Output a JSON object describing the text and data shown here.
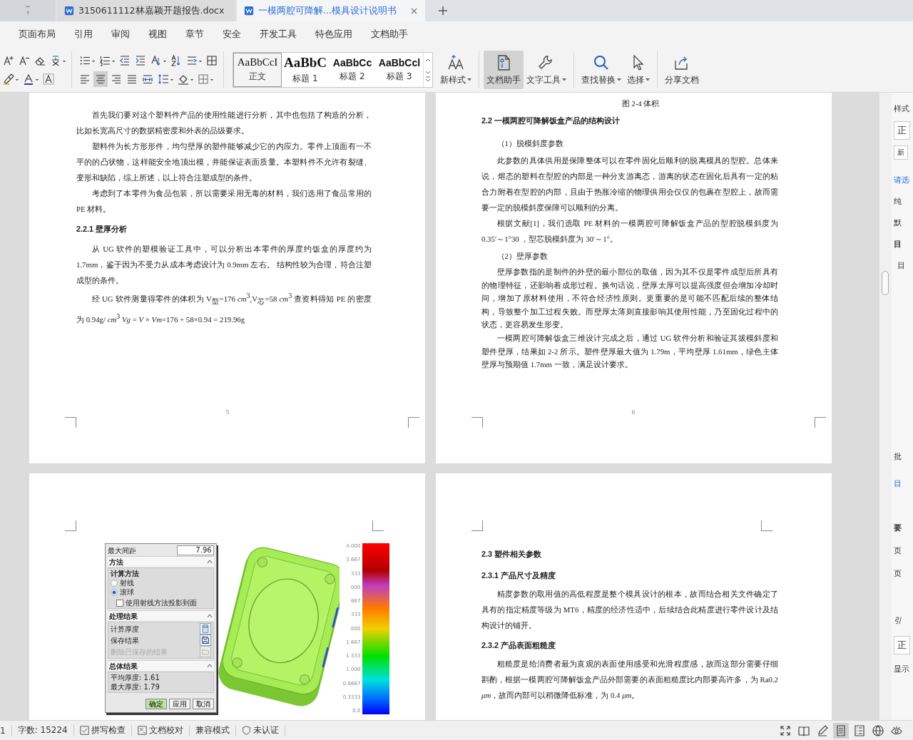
{
  "tabs": [
    {
      "kind": "home",
      "selected": false
    },
    {
      "kind": "doc",
      "title": "3150611112林嘉颖开题报告.docx",
      "selected": false
    },
    {
      "kind": "doc",
      "title": "一模两腔可降解...模具设计说明书",
      "selected": true
    }
  ],
  "menu": [
    "页面布局",
    "引用",
    "审阅",
    "视图",
    "章节",
    "安全",
    "开发工具",
    "特色应用",
    "文档助手"
  ],
  "format_groups": [
    {
      "rows": [
        {
          "tools": [
            {
              "kind": "font-grow",
              "dropdown": false,
              "selected": false
            },
            {
              "kind": "font-shrink",
              "dropdown": false,
              "selected": false
            },
            {
              "kind": "clear-format",
              "dropdown": false,
              "selected": false
            },
            {
              "kind": "pinyin",
              "dropdown": true,
              "selected": false
            }
          ]
        },
        {
          "tools": [
            {
              "kind": "highlight",
              "dropdown": true,
              "selected": false
            },
            {
              "kind": "font-color",
              "dropdown": true,
              "selected": false
            },
            {
              "kind": "char-shading",
              "dropdown": false,
              "selected": false
            }
          ]
        }
      ]
    },
    {
      "rows": [
        {
          "tools": [
            {
              "kind": "bullet-list",
              "dropdown": true,
              "selected": false
            },
            {
              "kind": "numbered-list",
              "dropdown": true,
              "selected": false
            },
            {
              "kind": "outdent",
              "dropdown": false,
              "selected": false
            },
            {
              "kind": "indent",
              "dropdown": false,
              "selected": false
            },
            {
              "kind": "text-direction",
              "dropdown": true,
              "selected": false
            },
            {
              "kind": "sort",
              "dropdown": false,
              "selected": false
            },
            {
              "kind": "para-layout",
              "dropdown": true,
              "selected": false
            },
            {
              "kind": "table",
              "dropdown": false,
              "selected": false
            }
          ]
        },
        {
          "tools": [
            {
              "kind": "align-left",
              "dropdown": false,
              "selected": false
            },
            {
              "kind": "align-center",
              "dropdown": false,
              "selected": true
            },
            {
              "kind": "align-right",
              "dropdown": false,
              "selected": false
            },
            {
              "kind": "justify",
              "dropdown": false,
              "selected": false
            },
            {
              "kind": "distribute",
              "dropdown": false,
              "selected": false
            },
            {
              "kind": "line-spacing",
              "dropdown": true,
              "selected": false
            },
            {
              "kind": "shading",
              "dropdown": true,
              "selected": false
            },
            {
              "kind": "borders",
              "dropdown": true,
              "selected": false
            }
          ]
        }
      ]
    }
  ],
  "styles": [
    {
      "sample": "AaBbCcI",
      "label": "正文",
      "selected": true
    },
    {
      "sample": "AaBbC",
      "label": "标题 1",
      "selected": false
    },
    {
      "sample": "AaBbCc",
      "label": "标题 2",
      "selected": false
    },
    {
      "sample": "AaBbCcl",
      "label": "标题 3",
      "selected": false
    }
  ],
  "big_tools": [
    {
      "kind": "new-style",
      "label": "新样式",
      "dropdown": true,
      "selected": false
    },
    {
      "kind": "doc-assistant",
      "label": "文档助手",
      "dropdown": false,
      "selected": true
    },
    {
      "kind": "text-tools",
      "label": "文字工具",
      "dropdown": true,
      "selected": false
    },
    {
      "kind": "find-replace",
      "label": "查找替换",
      "dropdown": true,
      "selected": false
    },
    {
      "kind": "select",
      "label": "选择",
      "dropdown": true,
      "selected": false
    },
    {
      "kind": "share",
      "label": "分享文档",
      "dropdown": false,
      "selected": false
    }
  ],
  "pages": [
    {
      "page_number": "5",
      "blocks": [
        {
          "kind": "para",
          "text": "首先我们要对这个塑料件产品的使用性能进行分析，其中也包括了构造的分析，比如长宽高尺寸的数据精密度和外表的品级要求。"
        },
        {
          "kind": "para",
          "text": "塑料件为长方形形件，均匀壁厚的塑件能够减少它的内应力。零件上顶面有一不平的的凸状物，这样能安全地顶出模，并能保证表面质量。本塑料件不允许有裂缝、变形和缺陷，综上所述，以上符合注塑成型的条件。"
        },
        {
          "kind": "para",
          "text": "考虑到了本零件为食品包装，所以需要采用无毒的材料，我们选用了食品常用的 PE 材料。"
        },
        {
          "kind": "heading",
          "text": "2.2.1 壁厚分析"
        },
        {
          "kind": "para",
          "text": "从 UG 软件的塑模验证工具中，可以分析出本零件的厚度约饭盒的厚度约为 1.7mm，鉴于因为不受力从成本考虑设计为 0.9mm 左右。 结构性较为合理，符合注塑成型的条件。"
        },
        {
          "kind": "para",
          "text": "经 UG 软件测量得零件的体积为 V$_{型}$=176 *cm*$^{3}$,V$_{芯}$=58 *cm*$^{3}$ 查资料得知 PE 的密度为 0.94g/ *cm*$^{3}$   *Vg* = *V* × *Vm*=176 + 58×0.94 = 219.96g"
        }
      ]
    },
    {
      "page_number": "6",
      "blocks": [
        {
          "kind": "caption",
          "text": "图 2-4 体积"
        },
        {
          "kind": "heading",
          "text": "2.2  一模两腔可降解饭盒产品的结构设计"
        },
        {
          "kind": "sub",
          "text": "（1）脱模斜度参数"
        },
        {
          "kind": "para",
          "text": "此参数的具体供用是保障整体可以在零件固化后顺利的脱离模具的型腔。总体来说，熔态的塑料在型腔的内部是一种分支游离态，游离的状态在固化后具有一定的粘合力附着在型腔的内部，且由于热胀冷缩的物理供用会仅仅的包裹在型腔上，故而需要一定的脱模斜度保障可以顺利的分离。"
        },
        {
          "kind": "para",
          "text": "根据文献[1]，我们选取 PE 材料的一模两腔可降解饭盒产品的型腔脱模斜度为 0.35′～1°30 ，型芯脱模斜度为 30′～1°。"
        },
        {
          "kind": "sub",
          "text": "（2）壁厚参数"
        },
        {
          "kind": "para-tight",
          "text": "壁厚参数指的是制件的外壁的最小部位的取值，因为其不仅是零件成型后所具有的物理特征，还影响着成形过程。换句话说，壁厚太厚可以提高强度但会增加冷却时间，增加了原材料使用，不符合经济性原则。更重要的是可能不匹配后续的整体结构，导致整个加工过程失败。而壁厚太薄则直接影响其使用性能，乃至固化过程中的状态，更容易发生形变。"
        },
        {
          "kind": "para-tight",
          "text": "一模两腔可降解饭盒三维设计完成之后，通过 UG 软件分析和验证其拔模斜度和塑件壁厚，结果如 2-2 所示。塑件壁厚最大值为 1.79m，平均壁厚 1.61mm，绿色主体壁厚与预期值 1.7mm 一致，满足设计要求。"
        }
      ]
    },
    {
      "blocks": [
        {
          "kind": "figure",
          "dialog": {
            "field": {
              "label": "最大间距",
              "value": "7.96"
            },
            "sections": [
              {
                "title": "方法",
                "rows": [
                  {
                    "kind": "group-title",
                    "text": "计算方法"
                  },
                  {
                    "kind": "radio",
                    "text": "射线",
                    "selected": false
                  },
                  {
                    "kind": "radio",
                    "text": "滚球",
                    "selected": true
                  },
                  {
                    "kind": "checkbox",
                    "text": "使用射线方法投影到面",
                    "checked": false
                  }
                ]
              },
              {
                "title": "处理结果",
                "rows": [
                  {
                    "kind": "action",
                    "text": "计算厚度",
                    "disabled": false
                  },
                  {
                    "kind": "action",
                    "text": "保存结果",
                    "disabled": false
                  },
                  {
                    "kind": "action",
                    "text": "删除已保存的结果",
                    "disabled": true
                  }
                ]
              },
              {
                "title": "总体结果",
                "rows": [
                  {
                    "kind": "result",
                    "text": "平均厚度: 1.61"
                  },
                  {
                    "kind": "result",
                    "text": "最大厚度: 1.79"
                  }
                ]
              }
            ],
            "buttons": [
              "确定",
              "应用",
              "取消"
            ]
          },
          "legend": [
            "4.000",
            "3.667",
            "333",
            "000",
            "667",
            "333",
            "000",
            "1.667",
            "1.333",
            "1.000",
            "0.6667",
            "0.3333",
            "0.0"
          ]
        }
      ]
    },
    {
      "blocks": [
        {
          "kind": "heading",
          "text": "2.3 塑件相关参数"
        },
        {
          "kind": "heading",
          "text": "2.3.1 产品尺寸及精度"
        },
        {
          "kind": "para",
          "text": "精度参数的取用值的高低程度是整个模具设计的根本，故而结合相关文件确定了具有的指定精度等级为 MT6，精度的经济性适中，后续结合此精度进行零件设计及结构设计的铺开。"
        },
        {
          "kind": "heading",
          "text": "2.3.2 产品表面粗糙度"
        },
        {
          "kind": "para",
          "text": "粗糙度是给消费者最为直观的表面使用感受和光滑程度感，故而这部分需要仔细斟酌，根据一模两腔可降解饭盒产品外部需要的表面粗糙度比内部要高许多，为 Ra0.2 *μm*，故而内部可以稍微降低标准，为 0.4 *μm*。"
        }
      ]
    }
  ],
  "sidebar": {
    "sections": [
      {
        "items": [
          {
            "kind": "label",
            "text": "样式"
          },
          {
            "kind": "box",
            "text": "正"
          },
          {
            "kind": "small-box",
            "text": "新"
          }
        ]
      },
      {
        "items": [
          {
            "kind": "link",
            "text": "请选"
          },
          {
            "kind": "label",
            "text": "纯"
          },
          {
            "kind": "label",
            "text": "默"
          },
          {
            "kind": "bold",
            "text": "目"
          },
          {
            "kind": "indent",
            "text": "目"
          }
        ]
      },
      {
        "items": [
          {
            "kind": "label",
            "text": "批"
          },
          {
            "kind": "link",
            "text": "目"
          }
        ]
      },
      {
        "items": [
          {
            "kind": "bold",
            "text": "要"
          },
          {
            "kind": "label",
            "text": "页"
          },
          {
            "kind": "label",
            "text": "页"
          }
        ]
      },
      {
        "items": [
          {
            "kind": "italic",
            "text": "引"
          },
          {
            "kind": "box",
            "text": "正"
          },
          {
            "kind": "label",
            "text": "显示"
          }
        ]
      }
    ]
  },
  "status": {
    "items": [
      {
        "kind": "text",
        "text": "1"
      },
      {
        "kind": "text",
        "text": "字数: 15224"
      },
      {
        "kind": "spell",
        "text": "拼写检查"
      },
      {
        "kind": "proof",
        "text": "文档校对"
      },
      {
        "kind": "text",
        "text": "兼容模式"
      },
      {
        "kind": "shield",
        "text": "未认证"
      }
    ],
    "views": [
      {
        "kind": "fullscreen",
        "selected": false
      },
      {
        "kind": "reading",
        "selected": false
      },
      {
        "kind": "pen",
        "selected": false
      },
      {
        "kind": "page",
        "selected": true
      },
      {
        "kind": "outline",
        "selected": false
      },
      {
        "kind": "web",
        "selected": false
      },
      {
        "kind": "eye",
        "selected": false
      }
    ]
  }
}
